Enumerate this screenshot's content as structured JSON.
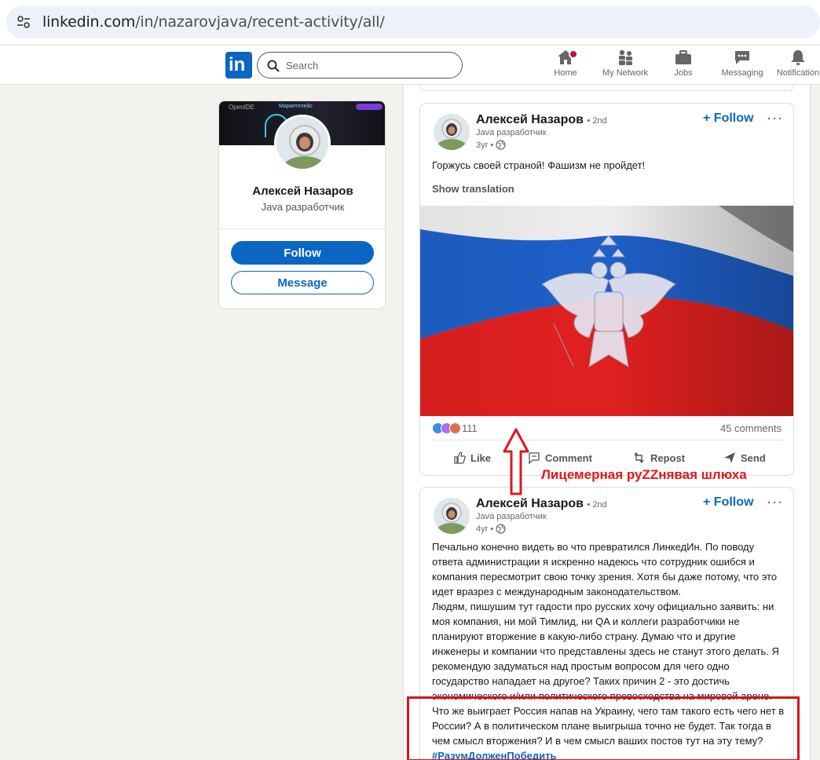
{
  "browser": {
    "url_host": "linkedin.com",
    "url_path": "/in/nazarovjava/recent-activity/all/"
  },
  "nav": {
    "logo": "in",
    "search_placeholder": "Search",
    "items": [
      {
        "label": "Home",
        "icon": "home-icon"
      },
      {
        "label": "My Network",
        "icon": "people-icon"
      },
      {
        "label": "Jobs",
        "icon": "briefcase-icon"
      },
      {
        "label": "Messaging",
        "icon": "chat-icon"
      },
      {
        "label": "Notification",
        "icon": "bell-icon"
      }
    ],
    "brand_color": "#0a66c2"
  },
  "profile": {
    "banner_title": "OpenIDE",
    "banner_subtitle": "Маркетплейс",
    "name": "Алексей Назаров",
    "title": "Java разработчик",
    "follow_label": "Follow",
    "message_label": "Message"
  },
  "posts": [
    {
      "author": "Алексей Назаров",
      "degree": "• 2nd",
      "headline": "Java разработчик",
      "age": "3yr •",
      "follow_label": "+ Follow",
      "more": "···",
      "text": "Горжусь своей страной! Фашизм не пройдет!",
      "show_translation": "Show translation",
      "reaction_count": "111",
      "comments": "45 comments",
      "actions": [
        "Like",
        "Comment",
        "Repost",
        "Send"
      ]
    },
    {
      "author": "Алексей Назаров",
      "degree": "• 2nd",
      "headline": "Java разработчик",
      "age": "4yr •",
      "follow_label": "+ Follow",
      "more": "···",
      "paragraphs": [
        "Печально конечно видеть во что превратился ЛинкедИн. По поводу ответа администрации я искренно надеюсь что сотрудник ошибся и компания пересмотрит свою точку зрения. Хотя бы даже потому, что это идет вразрез с международным законодательством.",
        "Людям, пишушим тут гадости про русских хочу официально заявить: ни моя компания, ни мой Тимлид, ни QA и коллеги разработчики не планируют вторжение в какую-либо страну. Думаю что и другие инженеры и компании что представлены здесь не станут этого делать. Я рекомендую задуматься над простым вопросом для чего одно государство нападает на другое? Таких причин 2 - это достичь экономического и/или политического превосходства на мировой арене.",
        "Что же выиграет Россия напав на Украину, чего там такого есть чего нет в России? А в политическом плане выигрыша точно не будет. Так тогда в чем смысл вторжения? И в чем смысл ваших постов тут на эту тему?"
      ],
      "hashtag": "#РазумДолженПобедить"
    }
  ],
  "annotation": {
    "caption": "Лицемерная руZZнявая шлюха",
    "color": "#e3161c"
  }
}
